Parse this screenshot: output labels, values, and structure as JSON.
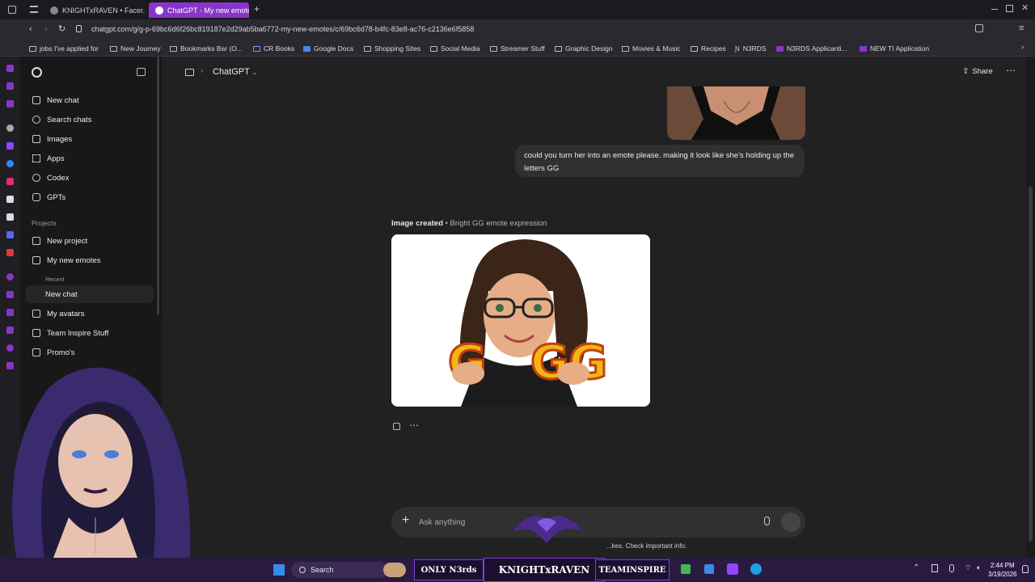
{
  "tabs": [
    {
      "title": "KNIGHTxRAVEN • Facer..."
    },
    {
      "title": "ChatGPT - My new emote"
    }
  ],
  "address": {
    "url": "chatgpt.com/g/g-p-69bc6d6f26bc819187e2d29ab5ba6772-my-new-emotes/c/69bc6d78-b4fc-83e8-ac76-c2136e6f5858"
  },
  "bookmarks": [
    "jobs I've applied for",
    "New Journey",
    "Bookmarks Bar (O...",
    "CR Books",
    "Google Docs",
    "Shopping Sites",
    "Social Media",
    "Streamer Stuff",
    "Graphic Design",
    "Movies & Music",
    "Recipes",
    "N3RDS",
    "N3RDS Applicanti...",
    "NEW TI Application"
  ],
  "sidebar": {
    "items": [
      {
        "label": "New chat"
      },
      {
        "label": "Search chats"
      },
      {
        "label": "Images"
      },
      {
        "label": "Apps"
      },
      {
        "label": "Codex"
      },
      {
        "label": "GPTs"
      }
    ],
    "projects_heading": "Projects",
    "projects": [
      {
        "label": "New project"
      },
      {
        "label": "My new emotes"
      }
    ],
    "recent_heading": "Recent",
    "recent_chat": "New chat",
    "more_projects": [
      {
        "label": "My avatars"
      },
      {
        "label": "Team Inspire Stuff"
      },
      {
        "label": "Promo's"
      }
    ]
  },
  "header": {
    "title": "ChatGPT",
    "share_label": "Share"
  },
  "conversation": {
    "user_message": "could you turn her into an emote please. making it look like she's holding up the letters GG",
    "image_created_label": "Image created",
    "image_title": "Bright GG emote expression"
  },
  "composer": {
    "placeholder": "Ask anything"
  },
  "disclaimer": "...kes. Check important info.",
  "taskbar": {
    "search_label": "Search",
    "time": "2:44 PM",
    "date": "3/19/2026",
    "banner_left": "ONLY N3rds",
    "banner_center": "KNIGHTxRAVEN",
    "banner_right": "TEAMINSPIRE"
  },
  "colors": {
    "accent": "#8a35c9",
    "bg": "#212121",
    "sidebar": "#181818"
  }
}
